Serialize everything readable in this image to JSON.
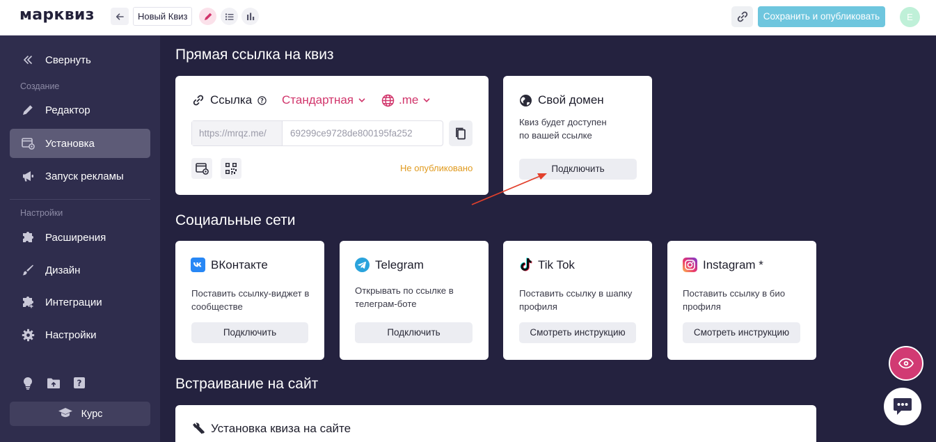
{
  "header": {
    "logo": "марквиз",
    "quiz_name": "Новый Квиз",
    "publish_label": "Сохранить и опубликовать",
    "avatar_letter": "E"
  },
  "sidebar": {
    "collapse_label": "Свернуть",
    "section_create": "Создание",
    "section_settings": "Настройки",
    "items": [
      {
        "label": "Редактор",
        "icon": "pencil-icon"
      },
      {
        "label": "Установка",
        "icon": "install-icon",
        "active": true
      },
      {
        "label": "Запуск рекламы",
        "icon": "megaphone-icon"
      },
      {
        "label": "Расширения",
        "icon": "puzzle-icon"
      },
      {
        "label": "Дизайн",
        "icon": "brush-icon"
      },
      {
        "label": "Интеграции",
        "icon": "integrations-icon"
      },
      {
        "label": "Настройки",
        "icon": "gear-icon"
      }
    ],
    "course_label": "Курс"
  },
  "main": {
    "direct_link_title": "Прямая ссылка на квиз",
    "link_card": {
      "title": "Ссылка",
      "type_label": "Стандартная",
      "domain_label": ".me",
      "url_prefix": "https://mrqz.me/",
      "url_id": "69299ce9728de800195fa252",
      "status": "Не опубликовано"
    },
    "domain_card": {
      "title": "Свой домен",
      "desc_line1": "Квиз будет доступен",
      "desc_line2": "по вашей ссылке",
      "button": "Подключить"
    },
    "social_title": "Социальные сети",
    "social_cards": [
      {
        "title": "ВКонтакте",
        "desc_line1": "Поставить ссылку-виджет в",
        "desc_line2": "сообществе",
        "button": "Подключить"
      },
      {
        "title": "Telegram",
        "desc_line1": "Открывать по ссылке в",
        "desc_line2": "телеграм-боте",
        "button": "Подключить"
      },
      {
        "title": "Tik Tok",
        "desc_line1": "Поставить ссылку в шапку",
        "desc_line2": "профиля",
        "button": "Смотреть инструкцию"
      },
      {
        "title": "Instagram *",
        "desc_line1": "Поставить ссылку в био",
        "desc_line2": "профиля",
        "button": "Смотреть инструкцию"
      }
    ],
    "embed_title": "Встраивание на сайт",
    "embed_card_title": "Установка квиза на сайте"
  },
  "colors": {
    "accent": "#d1356b",
    "publish": "#6ec6de",
    "sidebar_bg": "#2f2d4d",
    "main_bg": "#24223f",
    "status_warning": "#e09a1e"
  }
}
